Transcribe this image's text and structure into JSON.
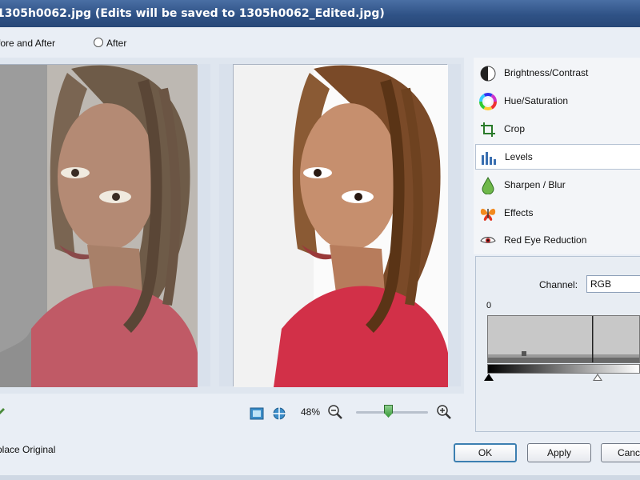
{
  "window": {
    "title": "1305h0062.jpg (Edits will be saved to 1305h0062_Edited.jpg)"
  },
  "view_mode": {
    "before_after_label": "fore and After",
    "after_label": "After",
    "selected": "before_after"
  },
  "tools": {
    "items": [
      {
        "label": "Brightness/Contrast",
        "icon": "brightness-contrast-icon"
      },
      {
        "label": "Hue/Saturation",
        "icon": "color-wheel-icon"
      },
      {
        "label": "Crop",
        "icon": "crop-icon"
      },
      {
        "label": "Levels",
        "icon": "levels-icon",
        "selected": true
      },
      {
        "label": "Sharpen / Blur",
        "icon": "droplet-icon"
      },
      {
        "label": "Effects",
        "icon": "butterfly-icon"
      },
      {
        "label": "Red Eye Reduction",
        "icon": "eye-icon"
      }
    ]
  },
  "levels": {
    "channel_label": "Channel:",
    "channel_value": "RGB",
    "input_black": "0"
  },
  "zoom": {
    "percent": "48%",
    "slider_position": 0.45
  },
  "footer": {
    "replace_original_label": "place Original",
    "ok_label": "OK",
    "apply_label": "Apply",
    "cancel_label": "Canc"
  },
  "colors": {
    "titlebar": "#2f5286",
    "selected_tool_border": "#b5c2d3",
    "ok_border": "#3c7fb1",
    "shirt_red": "#d23048"
  }
}
